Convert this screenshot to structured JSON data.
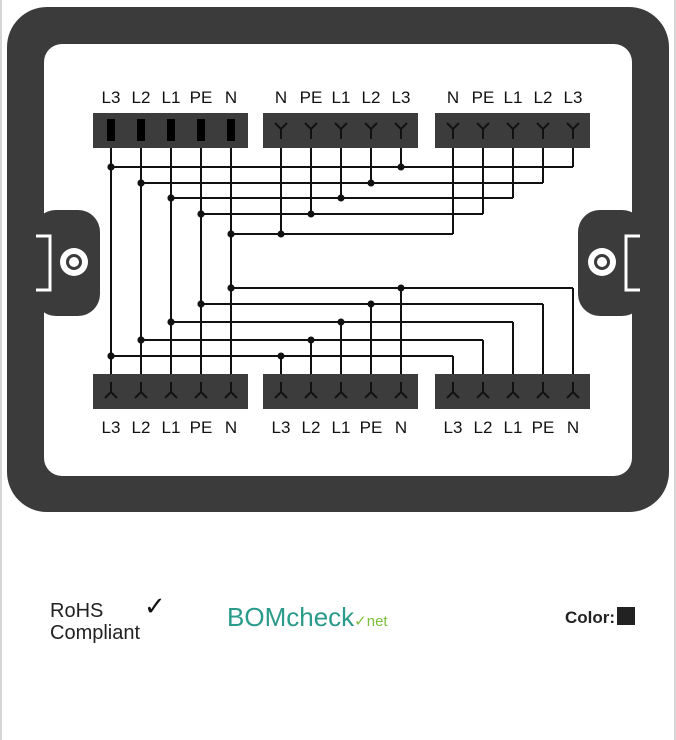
{
  "diagram": {
    "top_terminals": [
      {
        "labels": [
          "L3",
          "L2",
          "L1",
          "PE",
          "N"
        ]
      },
      {
        "labels": [
          "N",
          "PE",
          "L1",
          "L2",
          "L3"
        ]
      },
      {
        "labels": [
          "N",
          "PE",
          "L1",
          "L2",
          "L3"
        ]
      }
    ],
    "bottom_terminals": [
      {
        "labels": [
          "L3",
          "L2",
          "L1",
          "PE",
          "N"
        ]
      },
      {
        "labels": [
          "L3",
          "L2",
          "L1",
          "PE",
          "N"
        ]
      },
      {
        "labels": [
          "L3",
          "L2",
          "L1",
          "PE",
          "N"
        ]
      }
    ]
  },
  "footer": {
    "rohs_line1": "RoHS",
    "rohs_line2": "Compliant",
    "rohs_check": "✓",
    "bom_part1": "BOM",
    "bom_part2": "check",
    "bom_part3": "✓net",
    "color_label": "Color:",
    "color_value": "#222222"
  },
  "colors": {
    "housing": "#3a3a3a",
    "wire": "#111111",
    "brand": "#2a9a8a",
    "brand_accent": "#7bbf3a"
  }
}
